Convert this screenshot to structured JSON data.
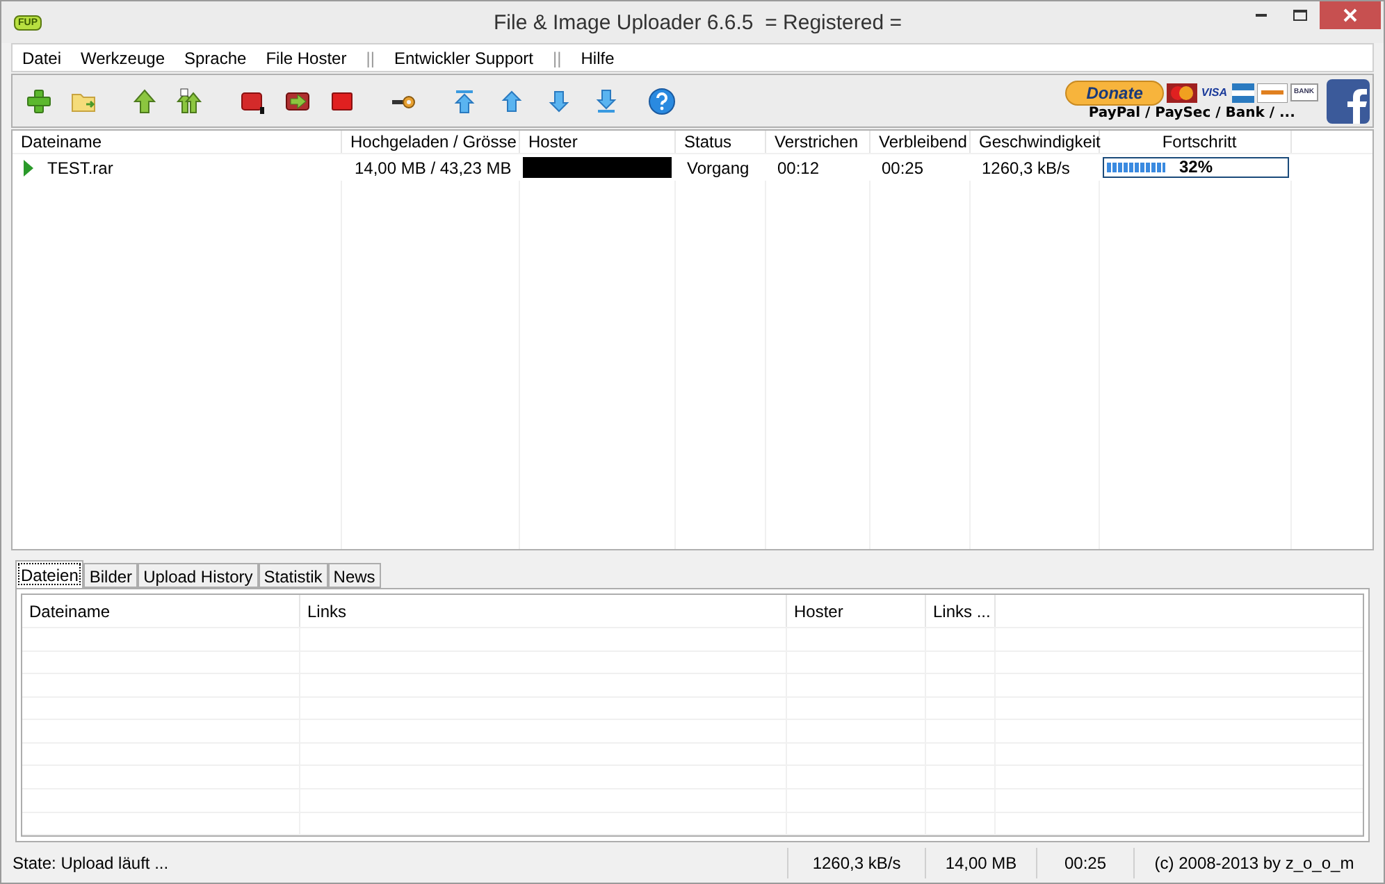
{
  "window": {
    "title": "File & Image Uploader 6.6.5  = Registered =",
    "app_badge": "FUP"
  },
  "menu": [
    {
      "label": "Datei",
      "kind": "item"
    },
    {
      "label": "Werkzeuge",
      "kind": "item"
    },
    {
      "label": "Sprache",
      "kind": "item"
    },
    {
      "label": "File Hoster",
      "kind": "item"
    },
    {
      "label": "||",
      "kind": "separator"
    },
    {
      "label": "Entwickler Support",
      "kind": "item"
    },
    {
      "label": "||",
      "kind": "separator"
    },
    {
      "label": "Hilfe",
      "kind": "item"
    }
  ],
  "donate": {
    "button": "Donate",
    "caption": "PayPal / PaySec / Bank / ...",
    "cards": [
      "VISA",
      "BANK"
    ]
  },
  "uploads": {
    "columns": [
      "Dateiname",
      "Hochgeladen / Grösse",
      "Hoster",
      "Status",
      "Verstrichen",
      "Verbleibend",
      "Geschwindigkeit",
      "Fortschritt"
    ],
    "rows": [
      {
        "name": "TEST.rar",
        "size": "14,00 MB / 43,23 MB",
        "hoster_redacted": true,
        "status": "Vorgang",
        "elapsed": "00:12",
        "remaining": "00:25",
        "speed": "1260,3 kB/s",
        "level": 0.32,
        "percent": "32%",
        "playing": true
      }
    ]
  },
  "tabs": [
    {
      "label": "Dateien",
      "selected": true
    },
    {
      "label": "Bilder",
      "selected": false
    },
    {
      "label": "Upload History",
      "selected": false
    },
    {
      "label": "Statistik",
      "selected": false
    },
    {
      "label": "News",
      "selected": false
    }
  ],
  "files": {
    "columns": [
      "Dateiname",
      "Links",
      "Hoster",
      "Links ..."
    ]
  },
  "status_bar": [
    "State: Upload läuft ...",
    "1260,3 kB/s",
    "14,00 MB",
    "00:25",
    "(c) 2008-2013 by z_o_o_m"
  ]
}
